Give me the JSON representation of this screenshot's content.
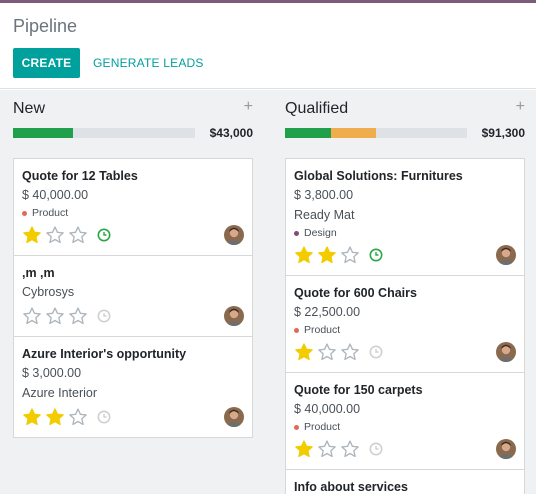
{
  "breadcrumb": "Pipeline",
  "buttons": {
    "create": "CREATE",
    "generate": "GENERATE LEADS"
  },
  "colors": {
    "accent": "#00a09d",
    "won": "#21a04b",
    "warn": "#f0ad4e",
    "progress_bg": "#dee2e6",
    "star_on": "#f3cc00",
    "star_off": "#adb5bd",
    "clock_ok": "#28a745",
    "clock_none": "#d0d0d0"
  },
  "columns": [
    {
      "title": "New",
      "amount": "$43,000",
      "progress": [
        {
          "color": "#21a04b",
          "fraction": 0.33
        }
      ],
      "cards": [
        {
          "title": "Quote for 12 Tables",
          "amount": "$ 40,000.00",
          "tag": "Product",
          "tag_color": "#e4675a",
          "stars": 1,
          "activity": "clock-ok"
        },
        {
          "title": ",m ,m",
          "customer": "Cybrosys",
          "stars": 0,
          "activity": "clock-none"
        },
        {
          "title": "Azure Interior's opportunity",
          "amount": "$ 3,000.00",
          "customer": "Azure Interior",
          "stars": 2,
          "activity": "clock-none"
        }
      ]
    },
    {
      "title": "Qualified",
      "amount": "$91,300",
      "progress": [
        {
          "color": "#21a04b",
          "fraction": 0.25
        },
        {
          "color": "#f0ad4e",
          "fraction": 0.25
        }
      ],
      "cards": [
        {
          "title": "Global Solutions: Furnitures",
          "amount": "$ 3,800.00",
          "customer": "Ready Mat",
          "tag": "Design",
          "tag_color": "#7b4d77",
          "stars": 2,
          "activity": "clock-ok"
        },
        {
          "title": "Quote for 600 Chairs",
          "amount": "$ 22,500.00",
          "tag": "Product",
          "tag_color": "#e4675a",
          "stars": 1,
          "activity": "clock-none"
        },
        {
          "title": "Quote for 150 carpets",
          "amount": "$ 40,000.00",
          "tag": "Product",
          "tag_color": "#e4675a",
          "stars": 1,
          "activity": "clock-none"
        },
        {
          "title": "Info about services"
        }
      ]
    }
  ]
}
